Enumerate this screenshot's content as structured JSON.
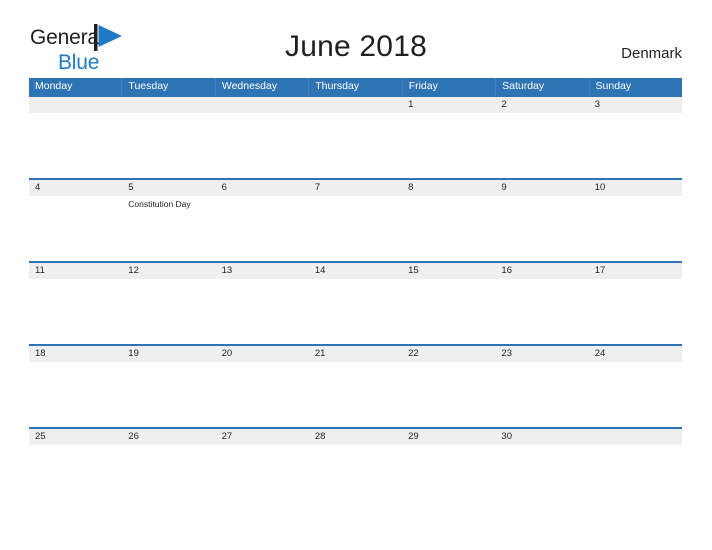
{
  "brand": {
    "name_part1": "General",
    "name_part2": "Blue",
    "icon": "flag-triangle-icon",
    "accent_color": "#1f7ac4",
    "text_color": "#231f20"
  },
  "header": {
    "title": "June 2018",
    "country": "Denmark"
  },
  "theme": {
    "header_blue": "#2e73b3",
    "date_strip_gray": "#efefef",
    "divider_blue": "#2e73b3"
  },
  "calendar": {
    "weekdays": [
      "Monday",
      "Tuesday",
      "Wednesday",
      "Thursday",
      "Friday",
      "Saturday",
      "Sunday"
    ],
    "weeks": [
      {
        "days": [
          {
            "date": "",
            "events": []
          },
          {
            "date": "",
            "events": []
          },
          {
            "date": "",
            "events": []
          },
          {
            "date": "",
            "events": []
          },
          {
            "date": "1",
            "events": []
          },
          {
            "date": "2",
            "events": []
          },
          {
            "date": "3",
            "events": []
          }
        ]
      },
      {
        "days": [
          {
            "date": "4",
            "events": []
          },
          {
            "date": "5",
            "events": [
              "Constitution Day"
            ]
          },
          {
            "date": "6",
            "events": []
          },
          {
            "date": "7",
            "events": []
          },
          {
            "date": "8",
            "events": []
          },
          {
            "date": "9",
            "events": []
          },
          {
            "date": "10",
            "events": []
          }
        ]
      },
      {
        "days": [
          {
            "date": "11",
            "events": []
          },
          {
            "date": "12",
            "events": []
          },
          {
            "date": "13",
            "events": []
          },
          {
            "date": "14",
            "events": []
          },
          {
            "date": "15",
            "events": []
          },
          {
            "date": "16",
            "events": []
          },
          {
            "date": "17",
            "events": []
          }
        ]
      },
      {
        "days": [
          {
            "date": "18",
            "events": []
          },
          {
            "date": "19",
            "events": []
          },
          {
            "date": "20",
            "events": []
          },
          {
            "date": "21",
            "events": []
          },
          {
            "date": "22",
            "events": []
          },
          {
            "date": "23",
            "events": []
          },
          {
            "date": "24",
            "events": []
          }
        ]
      },
      {
        "days": [
          {
            "date": "25",
            "events": []
          },
          {
            "date": "26",
            "events": []
          },
          {
            "date": "27",
            "events": []
          },
          {
            "date": "28",
            "events": []
          },
          {
            "date": "29",
            "events": []
          },
          {
            "date": "30",
            "events": []
          },
          {
            "date": "",
            "events": []
          }
        ]
      }
    ]
  }
}
